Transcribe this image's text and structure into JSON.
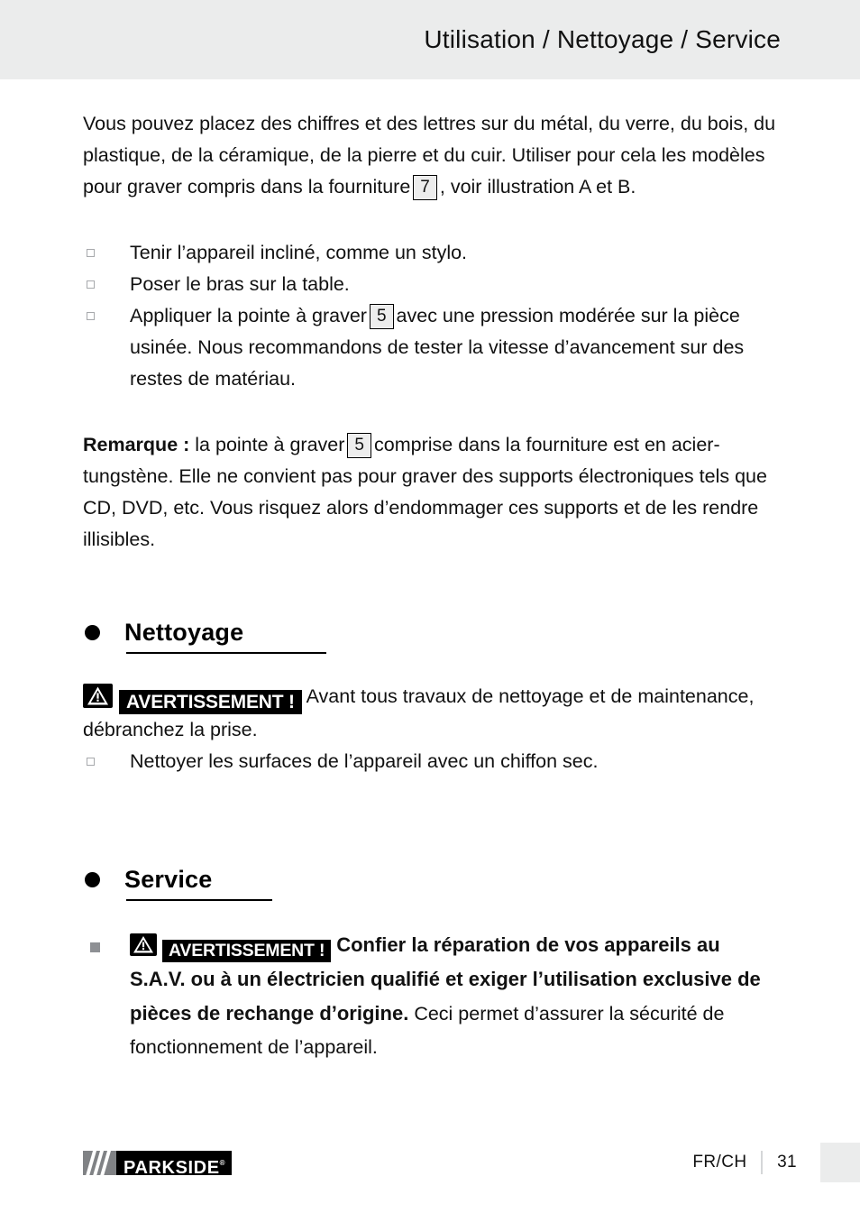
{
  "header": {
    "title": "Utilisation / Nettoyage / Service"
  },
  "intro": {
    "part1": "Vous pouvez placez des chiffres et des lettres sur du métal, du verre, du bois, du plastique, de la céramique, de la pierre et du cuir. Utiliser pour cela les modèles pour graver compris dans la fourniture",
    "ref": "7",
    "part2": ", voir illustration A et B."
  },
  "steps": {
    "items": [
      {
        "text": "Tenir l’appareil incliné, comme un stylo."
      },
      {
        "text": "Poser le bras sur la table."
      },
      {
        "pre": "Appliquer la pointe à graver",
        "ref": "5",
        "post": "avec une pression modérée sur la pièce usinée. Nous recommandons de tester la vitesse d’avancement sur des restes de matériau."
      }
    ]
  },
  "remark": {
    "label": "Remarque :",
    "pre": "la pointe à graver",
    "ref": "5",
    "post": "comprise dans la fourniture est en acier-tungstène. Elle ne convient pas pour graver des supports électroniques tels que CD, DVD, etc. Vous risquez alors d’endommager ces supports et de les rendre illisibles."
  },
  "nettoyage": {
    "heading": "Nettoyage",
    "warning_label": "AVERTISSEMENT !",
    "warning_text": "Avant tous travaux de nettoyage et de maintenance, débranchez la prise.",
    "items": [
      {
        "text": "Nettoyer les surfaces de l’appareil avec un chiffon sec."
      }
    ]
  },
  "service": {
    "heading": "Service",
    "warning_label": "AVERTISSEMENT !",
    "bold_text": "Confier la réparation de vos appareils au S.A.V. ou à un électricien qualifié et exiger l’utilisation exclusive de pièces de rechange d’origine.",
    "normal_text": "Ceci permet d’assurer la sécurité de fonctionnement de l’appareil."
  },
  "footer": {
    "brand": "PARKSIDE",
    "registered": "®",
    "language": "FR/CH",
    "page_number": "31"
  },
  "colors": {
    "header_bg": "#ebecec",
    "text": "#111111",
    "badge_bg": "#000000",
    "bullet_outline": "#a7a9ac",
    "bullet_filled": "#8e9094",
    "ref_box_bg": "#ededed"
  }
}
